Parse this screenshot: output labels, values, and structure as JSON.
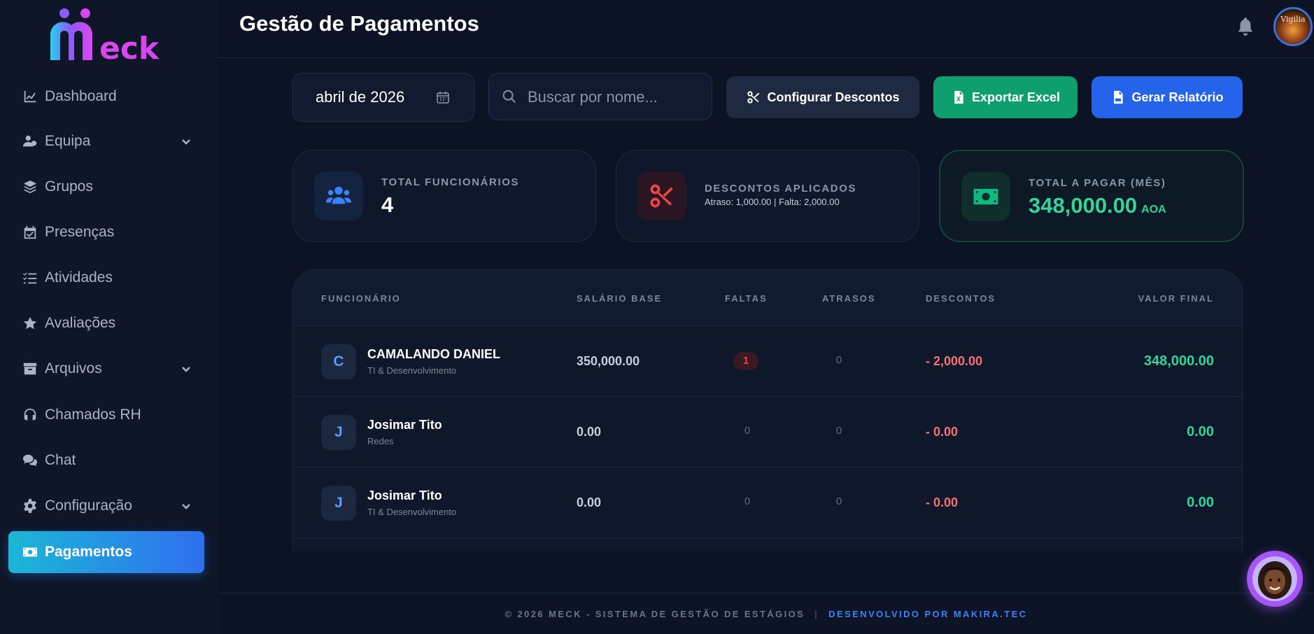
{
  "brand": {
    "logo_text": "eck"
  },
  "sidebar": {
    "items": [
      {
        "label": "Dashboard"
      },
      {
        "label": "Equipa"
      },
      {
        "label": "Grupos"
      },
      {
        "label": "Presenças"
      },
      {
        "label": "Atividades"
      },
      {
        "label": "Avaliações"
      },
      {
        "label": "Arquivos"
      },
      {
        "label": "Chamados RH"
      },
      {
        "label": "Chat"
      },
      {
        "label": "Configuração"
      },
      {
        "label": "Pagamentos",
        "active": true
      }
    ]
  },
  "header": {
    "title": "Gestão de Pagamentos",
    "avatar_text": "Vigilia"
  },
  "toolbar": {
    "month_value": "abril de 2026",
    "search_placeholder": "Buscar por nome...",
    "discount_button": "Configurar Descontos",
    "excel_button": "Exportar Excel",
    "report_button": "Gerar Relatório"
  },
  "stats": {
    "employees": {
      "label": "TOTAL FUNCIONÁRIOS",
      "value": "4"
    },
    "discounts": {
      "label": "DESCONTOS APLICADOS",
      "detail": "Atraso: 1,000.00 | Falta: 2,000.00"
    },
    "total": {
      "label": "TOTAL A PAGAR (MÊS)",
      "value": "348,000.00",
      "currency": "AOA"
    }
  },
  "table": {
    "headers": {
      "employee": "FUNCIONÁRIO",
      "salary": "SALÁRIO BASE",
      "absences": "FALTAS",
      "delays": "ATRASOS",
      "discounts": "DESCONTOS",
      "final": "VALOR FINAL"
    },
    "rows": [
      {
        "initial": "C",
        "name": "CAMALANDO DANIEL",
        "dept": "TI & Desenvolvimento",
        "salary": "350,000.00",
        "absences": "1",
        "delays": "0",
        "discount": "- 2,000.00",
        "final": "348,000.00"
      },
      {
        "initial": "J",
        "name": "Josimar Tito",
        "dept": "Redes",
        "salary": "0.00",
        "absences": "0",
        "delays": "0",
        "discount": "- 0.00",
        "final": "0.00"
      },
      {
        "initial": "J",
        "name": "Josimar Tito",
        "dept": "TI & Desenvolvimento",
        "salary": "0.00",
        "absences": "0",
        "delays": "0",
        "discount": "- 0.00",
        "final": "0.00"
      }
    ]
  },
  "footer": {
    "copyright": "© 2026 MECK - SISTEMA DE GESTÃO DE ESTÁGIOS",
    "separator": "|",
    "developer": "DESENVOLVIDO POR MAKIRA.TEC"
  },
  "colors": {
    "accent_blue": "#2563eb",
    "accent_green": "#10b981",
    "accent_red": "#ef4444",
    "logo_gradient_start": "#22d3ee",
    "logo_gradient_end": "#d946ef"
  }
}
